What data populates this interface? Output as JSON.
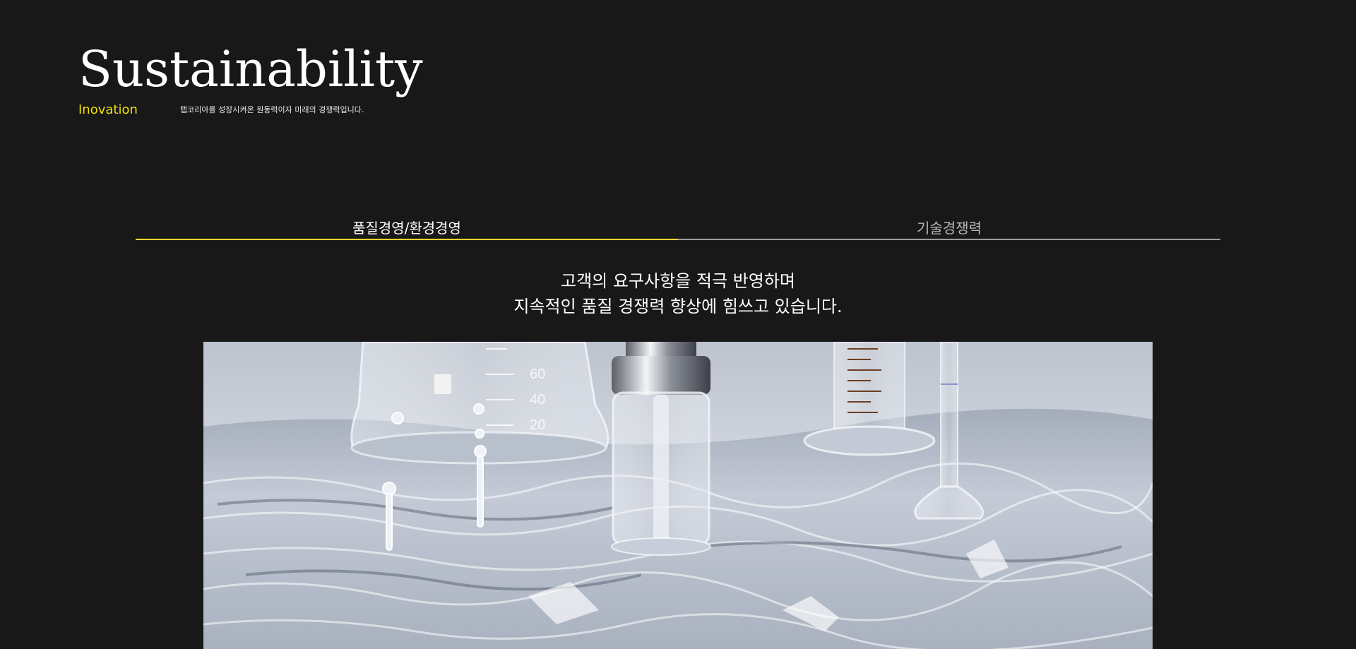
{
  "header": {
    "title": "Sustainability",
    "subtitle": "Inovation",
    "tagline": "탭코리아를 성장시켜온 원동력이자 미래의 경쟁력입니다."
  },
  "tabs": [
    {
      "label": "품질경영/환경경영",
      "active": true
    },
    {
      "label": "기술경쟁력",
      "active": false
    }
  ],
  "content": {
    "lead_line_1": "고객의 요구사항을 적극 반영하며",
    "lead_line_2": "지속적인 품질 경쟁력 향상에 힘쓰고 있습니다."
  },
  "hero_image": {
    "scale_labels": [
      "60",
      "40",
      "20"
    ]
  },
  "colors": {
    "background": "#181818",
    "accent": "#f2e000",
    "active_underline": "#e9d52b",
    "inactive_underline": "#9a9a9a"
  }
}
